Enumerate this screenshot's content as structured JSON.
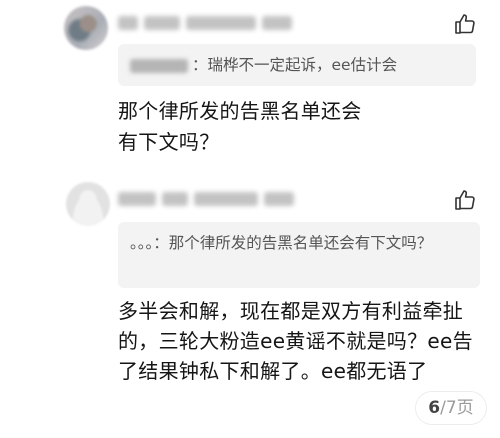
{
  "comments": [
    {
      "reply_quote": "：瑞桦不一定起诉，ee估计会",
      "text": "那个律所发的告黑名单还会有下文吗？",
      "like_icon": "thumbs-up-icon"
    },
    {
      "reply_quote": "。。。：那个律所发的告黑名单还会有下文吗？",
      "text": "多半会和解，现在都是双方有利益牵扯的，三轮大粉造ee黄谣不就是吗？ee告了结果钟私下和解了。ee都无语了",
      "like_icon": "thumbs-up-icon"
    }
  ],
  "pager": {
    "current": "6",
    "rest": "/7页"
  }
}
